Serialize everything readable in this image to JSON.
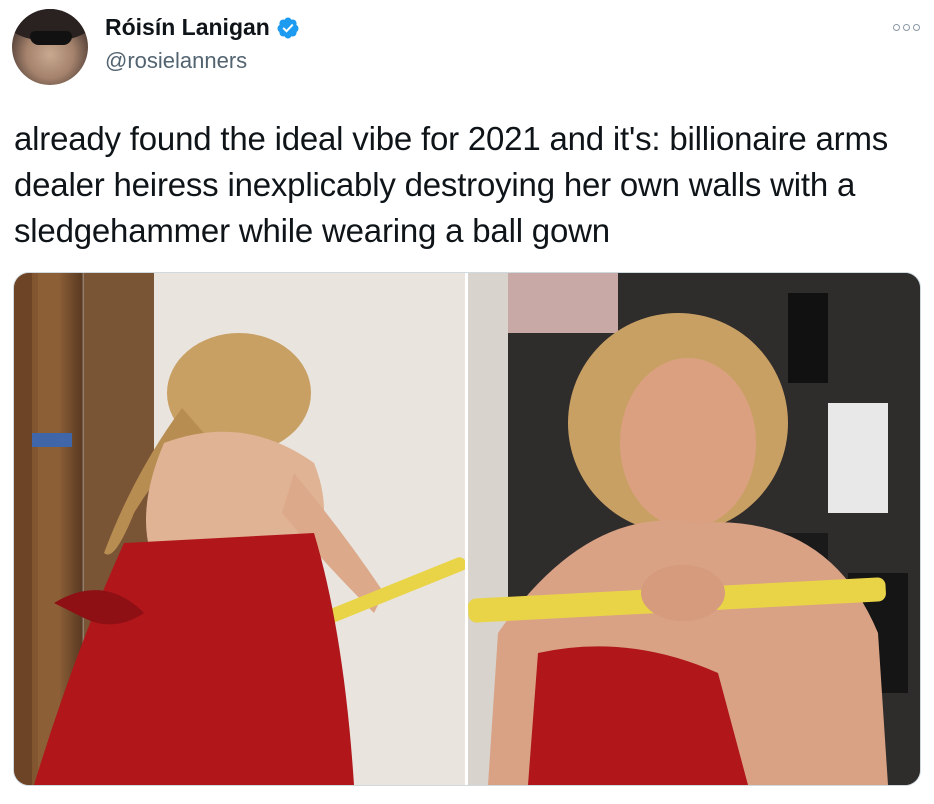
{
  "author": {
    "display_name": "Róisín Lanigan",
    "handle": "@rosielanners",
    "verified": true,
    "avatar_icon": "avatar"
  },
  "tweet": {
    "text": "already found the ideal vibe for 2021 and it's: billionaire arms dealer heiress inexplicably destroying her own walls with a sledgehammer while wearing a ball gown"
  },
  "media": {
    "count": 2,
    "photos": [
      {
        "description_icon": "photo-woman-red-dress-hammering-wall"
      },
      {
        "description_icon": "photo-woman-red-dress-holding-hammer"
      }
    ]
  },
  "colors": {
    "verified_badge": "#1d9bf0",
    "handle_text": "#536471",
    "dress_red": "#b0161a",
    "hammer_yellow": "#e9d447"
  }
}
